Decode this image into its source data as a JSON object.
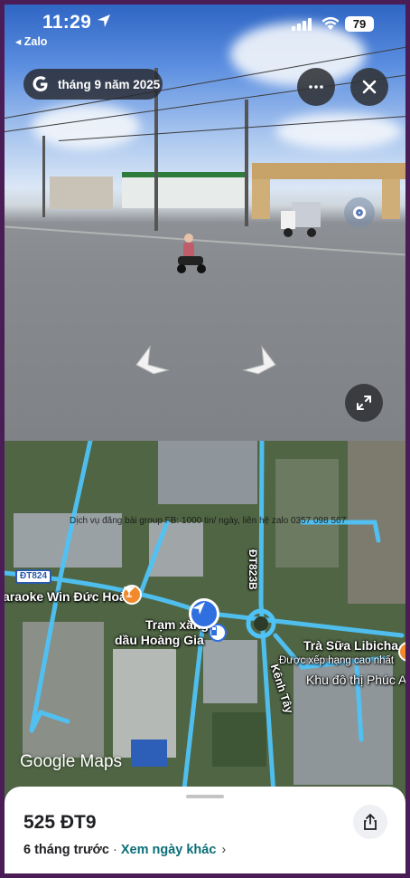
{
  "status_bar": {
    "time": "11:29",
    "back_app": "◂ Zalo",
    "battery": "79"
  },
  "street_view": {
    "date_label": "tháng 9 năm 2025",
    "more_icon": "more-horiz-icon",
    "close_icon": "close-icon",
    "expand_icon": "fullscreen-icon",
    "nav_left_icon": "arrow-left-icon",
    "nav_right_icon": "arrow-right-icon"
  },
  "map": {
    "watermark": "Dịch vụ đăng bài group FB: 1000 tin/ ngày, liên hệ zalo 0357 098 567",
    "route_badge": "ĐT824",
    "road_vertical_label": "ĐT823B",
    "road_kenh_tay": "Kênh Tây",
    "poi_karaoke": "araoke Win Đức Hoà",
    "poi_gas_line1": "Trạm xăng",
    "poi_gas_line2": "dầu Hoàng Gia",
    "poi_tea": "Trà Sữa Libicha",
    "poi_tea_sub": "Được xếp hạng cao nhất",
    "poi_urban": "Khu đô thị Phúc A",
    "brand": "Google Maps"
  },
  "sheet": {
    "title": "525 ĐT9",
    "ago": "6 tháng trước",
    "separator": " · ",
    "other_dates": "Xem ngày khác",
    "chevron": "›"
  },
  "colors": {
    "road_highlight": "#4fc3f7",
    "accent_teal": "#0b6e78",
    "poi_orange": "#f08a2c",
    "location_blue": "#2f6fe0"
  }
}
